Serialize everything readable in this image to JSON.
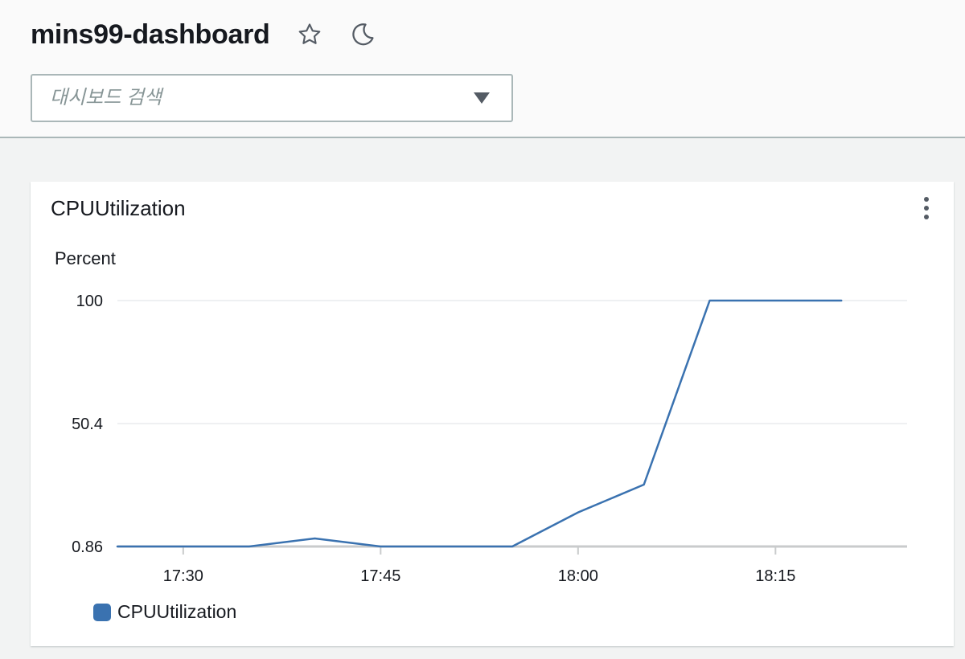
{
  "header": {
    "title": "mins99-dashboard",
    "star_icon": "star-outline-icon",
    "theme_icon": "moon-icon"
  },
  "search": {
    "placeholder": "대시보드 검색"
  },
  "widget": {
    "title": "CPUUtilization",
    "menu_icon": "more-vertical-icon"
  },
  "colors": {
    "series": "#3a72b0",
    "gridline": "#e9ebed",
    "baseline": "#c9cbcc"
  },
  "chart_data": {
    "type": "line",
    "title": "CPUUtilization",
    "ylabel": "Percent",
    "xlabel": "",
    "y_ticks": [
      "100",
      "50.4",
      "0.86"
    ],
    "y_tick_values": [
      100,
      50.4,
      0.86
    ],
    "ylim": [
      0.86,
      100
    ],
    "x_ticks": [
      "17:30",
      "17:45",
      "18:00",
      "18:15"
    ],
    "x": [
      "17:25",
      "17:30",
      "17:35",
      "17:40",
      "17:45",
      "17:50",
      "17:55",
      "18:00",
      "18:05",
      "18:10",
      "18:15",
      "18:20"
    ],
    "xlim": [
      "17:25",
      "18:25"
    ],
    "series": [
      {
        "name": "CPUUtilization",
        "color": "#3a72b0",
        "values": [
          0.86,
          0.86,
          0.86,
          4.1,
          0.86,
          0.86,
          0.86,
          14.6,
          25.8,
          100,
          100,
          100
        ]
      }
    ],
    "legend": "bottom-left",
    "grid": true
  }
}
